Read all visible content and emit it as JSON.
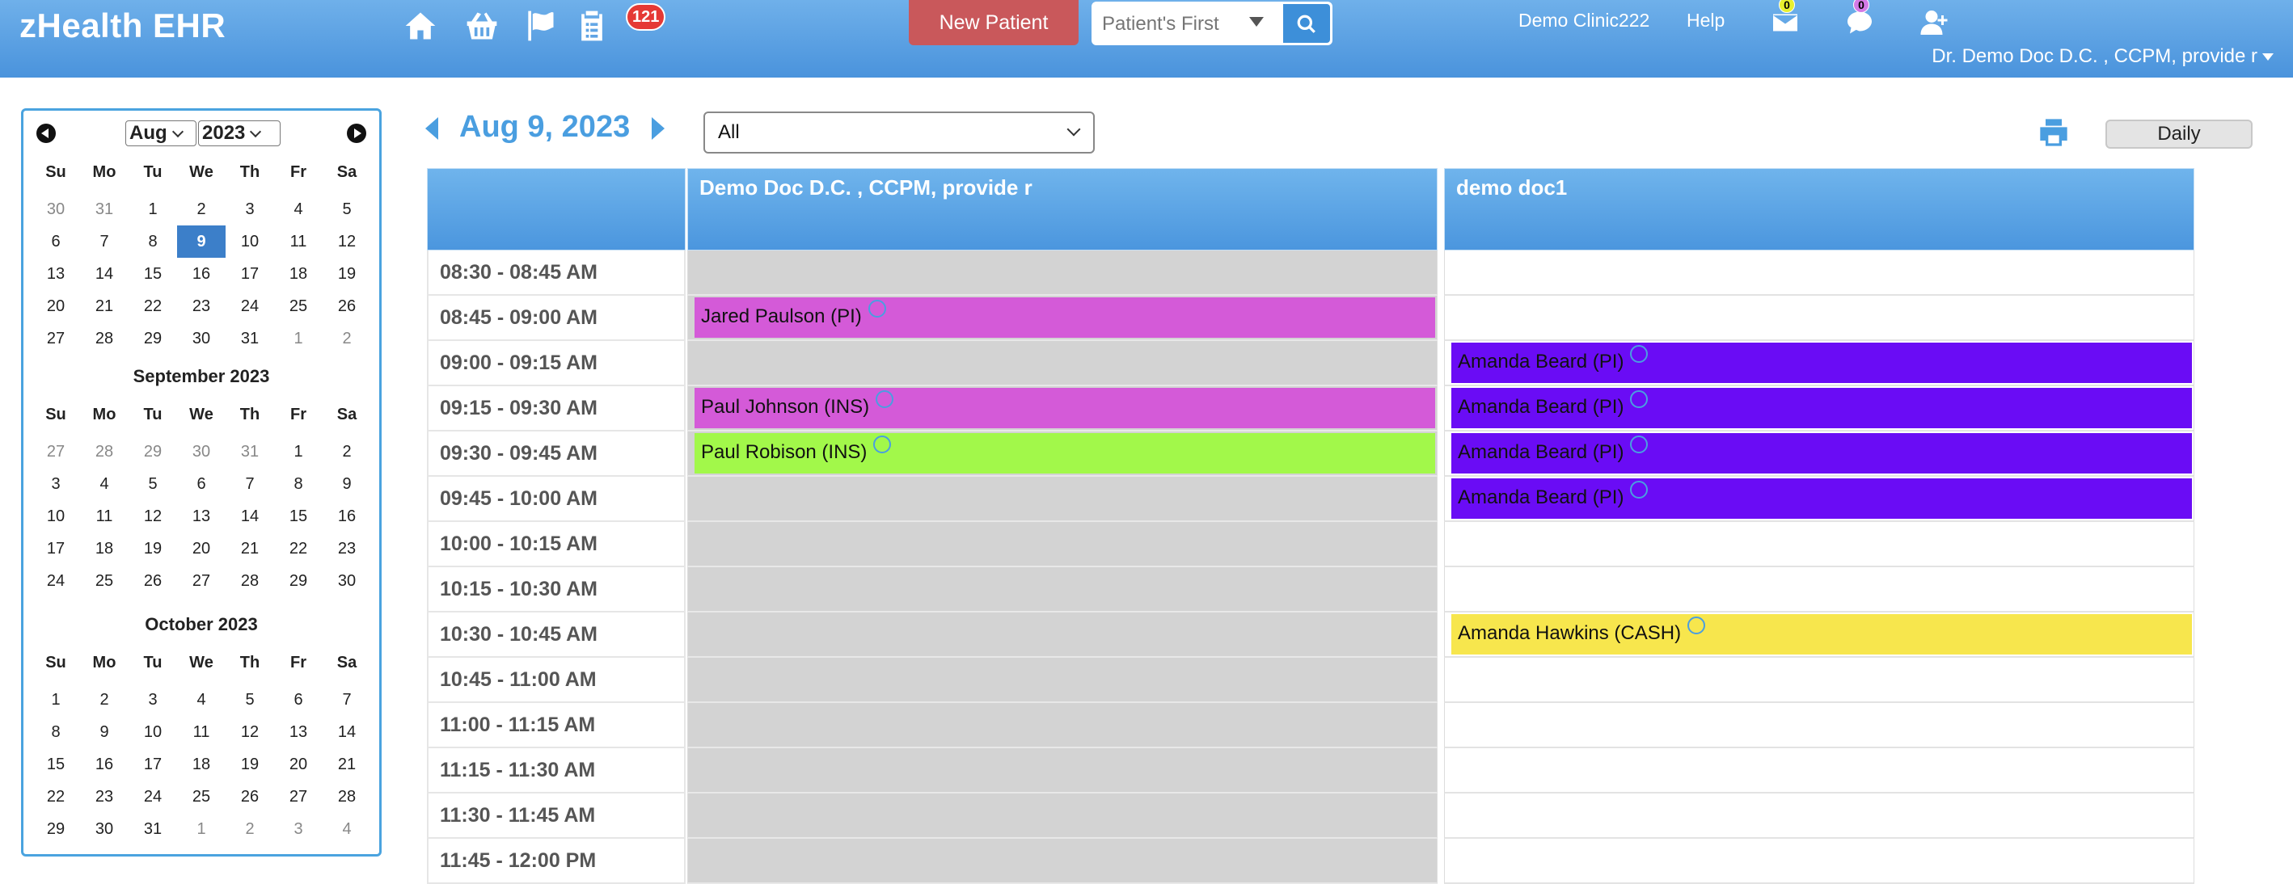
{
  "app": {
    "brand": "zHealth EHR"
  },
  "topbar": {
    "notif_count": "121",
    "new_patient_label": "New Patient",
    "search_placeholder": "Patient's First Name",
    "clinic": "Demo Clinic222",
    "help": "Help",
    "mail_count": "0",
    "chat_count": "0",
    "user": "Dr. Demo Doc D.C. , CCPM, provide r"
  },
  "mini_calendar": {
    "month_select": "Aug",
    "year_select": "2023",
    "weekdays": [
      "Su",
      "Mo",
      "Tu",
      "We",
      "Th",
      "Fr",
      "Sa"
    ],
    "months": [
      {
        "title": "",
        "weeks": [
          [
            "30",
            "31",
            "1",
            "2",
            "3",
            "4",
            "5"
          ],
          [
            "6",
            "7",
            "8",
            "9",
            "10",
            "11",
            "12"
          ],
          [
            "13",
            "14",
            "15",
            "16",
            "17",
            "18",
            "19"
          ],
          [
            "20",
            "21",
            "22",
            "23",
            "24",
            "25",
            "26"
          ],
          [
            "27",
            "28",
            "29",
            "30",
            "31",
            "1",
            "2"
          ]
        ],
        "muted": [
          [
            0,
            0
          ],
          [
            0,
            1
          ],
          [
            4,
            5
          ],
          [
            4,
            6
          ]
        ],
        "selected": [
          1,
          3
        ]
      },
      {
        "title": "September 2023",
        "weeks": [
          [
            "27",
            "28",
            "29",
            "30",
            "31",
            "1",
            "2"
          ],
          [
            "3",
            "4",
            "5",
            "6",
            "7",
            "8",
            "9"
          ],
          [
            "10",
            "11",
            "12",
            "13",
            "14",
            "15",
            "16"
          ],
          [
            "17",
            "18",
            "19",
            "20",
            "21",
            "22",
            "23"
          ],
          [
            "24",
            "25",
            "26",
            "27",
            "28",
            "29",
            "30"
          ]
        ],
        "muted": [
          [
            0,
            0
          ],
          [
            0,
            1
          ],
          [
            0,
            2
          ],
          [
            0,
            3
          ],
          [
            0,
            4
          ]
        ],
        "selected": null
      },
      {
        "title": "October 2023",
        "weeks": [
          [
            "1",
            "2",
            "3",
            "4",
            "5",
            "6",
            "7"
          ],
          [
            "8",
            "9",
            "10",
            "11",
            "12",
            "13",
            "14"
          ],
          [
            "15",
            "16",
            "17",
            "18",
            "19",
            "20",
            "21"
          ],
          [
            "22",
            "23",
            "24",
            "25",
            "26",
            "27",
            "28"
          ],
          [
            "29",
            "30",
            "31",
            "1",
            "2",
            "3",
            "4"
          ]
        ],
        "muted": [
          [
            4,
            3
          ],
          [
            4,
            4
          ],
          [
            4,
            5
          ],
          [
            4,
            6
          ]
        ],
        "selected": null
      }
    ]
  },
  "schedule": {
    "date": "Aug 9, 2023",
    "filter": "All",
    "view": "Daily",
    "time_slots": [
      "08:30 - 08:45 AM",
      "08:45 - 09:00 AM",
      "09:00 - 09:15 AM",
      "09:15 - 09:30 AM",
      "09:30 - 09:45 AM",
      "09:45 - 10:00 AM",
      "10:00 - 10:15 AM",
      "10:15 - 10:30 AM",
      "10:30 - 10:45 AM",
      "10:45 - 11:00 AM",
      "11:00 - 11:15 AM",
      "11:15 - 11:30 AM",
      "11:30 - 11:45 AM",
      "11:45 - 12:00 PM"
    ],
    "providers": [
      {
        "name": "Demo Doc D.C. , CCPM, provide r",
        "unavailable": true,
        "appointments": [
          {
            "slot": 1,
            "label": "Jared Paulson (PI)",
            "color": "#d45ad8"
          },
          {
            "slot": 3,
            "label": "Paul Johnson (INS)",
            "color": "#d45ad8"
          },
          {
            "slot": 4,
            "label": "Paul Robison (INS)",
            "color": "#a2f84a"
          }
        ]
      },
      {
        "name": "demo doc1",
        "unavailable": false,
        "appointments": [
          {
            "slot": 2,
            "label": "Amanda Beard (PI)",
            "color": "#6a0cf5"
          },
          {
            "slot": 3,
            "label": "Amanda Beard (PI)",
            "color": "#6a0cf5"
          },
          {
            "slot": 4,
            "label": "Amanda Beard (PI)",
            "color": "#6a0cf5"
          },
          {
            "slot": 5,
            "label": "Amanda Beard (PI)",
            "color": "#6a0cf5"
          },
          {
            "slot": 8,
            "label": "Amanda Hawkins (CASH)",
            "color": "#f7e64d"
          }
        ]
      }
    ]
  }
}
